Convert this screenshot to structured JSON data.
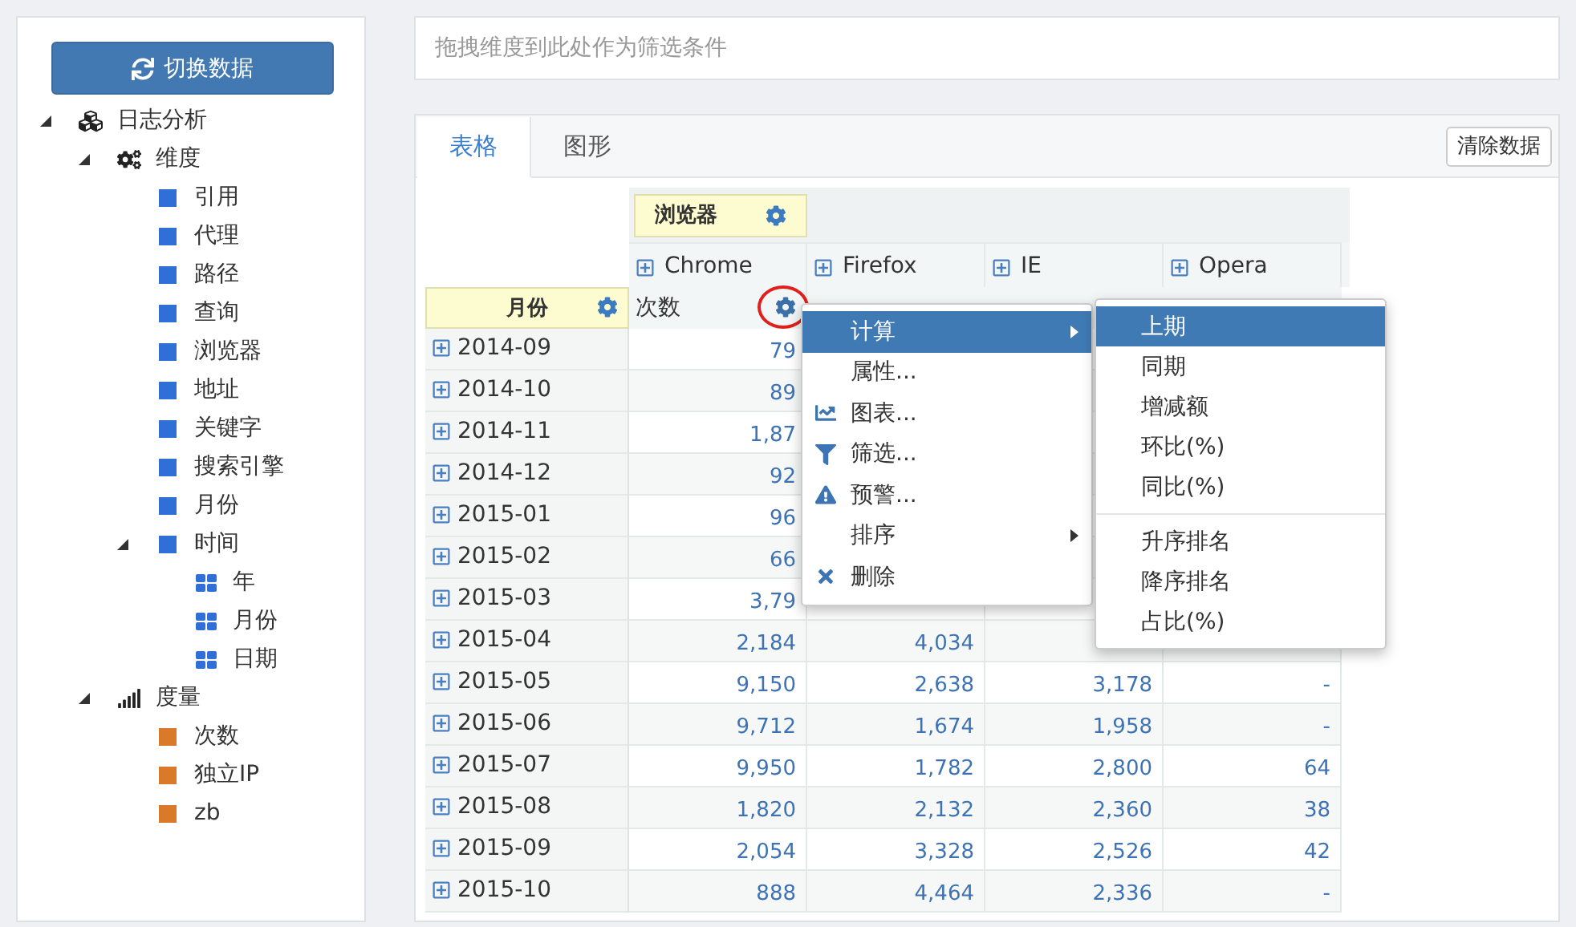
{
  "switch_button": {
    "label": "切换数据"
  },
  "tree": [
    {
      "label": "日志分析",
      "kind": "cube",
      "expanded": true,
      "children": [
        {
          "label": "维度",
          "kind": "gears",
          "expanded": true,
          "children": [
            {
              "label": "引用",
              "kind": "dim"
            },
            {
              "label": "代理",
              "kind": "dim"
            },
            {
              "label": "路径",
              "kind": "dim"
            },
            {
              "label": "查询",
              "kind": "dim"
            },
            {
              "label": "浏览器",
              "kind": "dim"
            },
            {
              "label": "地址",
              "kind": "dim"
            },
            {
              "label": "关键字",
              "kind": "dim"
            },
            {
              "label": "搜索引擎",
              "kind": "dim"
            },
            {
              "label": "月份",
              "kind": "dim"
            },
            {
              "label": "时间",
              "kind": "dim",
              "expanded": true,
              "children": [
                {
                  "label": "年",
                  "kind": "level"
                },
                {
                  "label": "月份",
                  "kind": "level"
                },
                {
                  "label": "日期",
                  "kind": "level"
                }
              ]
            }
          ]
        },
        {
          "label": "度量",
          "kind": "bars",
          "expanded": true,
          "children": [
            {
              "label": "次数",
              "kind": "measure"
            },
            {
              "label": "独立IP",
              "kind": "measure"
            },
            {
              "label": "zb",
              "kind": "measure"
            }
          ]
        }
      ]
    }
  ],
  "filter_zone": {
    "placeholder": "拖拽维度到此处作为筛选条件"
  },
  "tabs": [
    {
      "label": "表格",
      "selected": true
    },
    {
      "label": "图形",
      "selected": false
    }
  ],
  "clear_button": {
    "label": "清除数据"
  },
  "pivot": {
    "column_dimension": "浏览器",
    "row_dimension": "月份",
    "columns": [
      "Chrome",
      "Firefox",
      "IE",
      "Opera"
    ],
    "chrome_measure": "次数",
    "rows": [
      {
        "label": "2014-09",
        "cells": [
          "79",
          null,
          null,
          null
        ]
      },
      {
        "label": "2014-10",
        "cells": [
          "89",
          null,
          null,
          null
        ]
      },
      {
        "label": "2014-11",
        "cells": [
          "1,87",
          null,
          null,
          null
        ]
      },
      {
        "label": "2014-12",
        "cells": [
          "92",
          null,
          null,
          null
        ]
      },
      {
        "label": "2015-01",
        "cells": [
          "96",
          null,
          null,
          null
        ]
      },
      {
        "label": "2015-02",
        "cells": [
          "66",
          null,
          null,
          null
        ]
      },
      {
        "label": "2015-03",
        "cells": [
          "3,79",
          null,
          null,
          null
        ]
      },
      {
        "label": "2015-04",
        "cells": [
          "2,184",
          "4,034",
          null,
          null
        ]
      },
      {
        "label": "2015-05",
        "cells": [
          "9,150",
          "2,638",
          "3,178",
          "-"
        ]
      },
      {
        "label": "2015-06",
        "cells": [
          "9,712",
          "1,674",
          "1,958",
          "-"
        ]
      },
      {
        "label": "2015-07",
        "cells": [
          "9,950",
          "1,782",
          "2,800",
          "64"
        ]
      },
      {
        "label": "2015-08",
        "cells": [
          "1,820",
          "2,132",
          "2,360",
          "38"
        ]
      },
      {
        "label": "2015-09",
        "cells": [
          "2,054",
          "3,328",
          "2,526",
          "42"
        ]
      },
      {
        "label": "2015-10",
        "cells": [
          "888",
          "4,464",
          "2,336",
          "-"
        ]
      }
    ]
  },
  "context_menu": [
    {
      "label": "计算",
      "kind": "plain",
      "submenu": true,
      "selected": true
    },
    {
      "label": "属性...",
      "kind": "plain",
      "submenu": false,
      "selected": false
    },
    {
      "label": "图表...",
      "kind": "chart",
      "submenu": false,
      "selected": false
    },
    {
      "label": "筛选...",
      "kind": "filter",
      "submenu": false,
      "selected": false
    },
    {
      "label": "预警...",
      "kind": "warning",
      "submenu": false,
      "selected": false
    },
    {
      "label": "排序",
      "kind": "plain",
      "submenu": true,
      "selected": false
    },
    {
      "label": "删除",
      "kind": "delete",
      "submenu": false,
      "selected": false
    }
  ],
  "submenu_groups": [
    [
      {
        "label": "上期",
        "selected": true
      },
      {
        "label": "同期",
        "selected": false
      },
      {
        "label": "增减额",
        "selected": false
      },
      {
        "label": "环比(%)",
        "selected": false
      },
      {
        "label": "同比(%)",
        "selected": false
      }
    ],
    [
      {
        "label": "升序排名",
        "selected": false
      },
      {
        "label": "降序排名",
        "selected": false
      },
      {
        "label": "占比(%)",
        "selected": false
      }
    ]
  ]
}
